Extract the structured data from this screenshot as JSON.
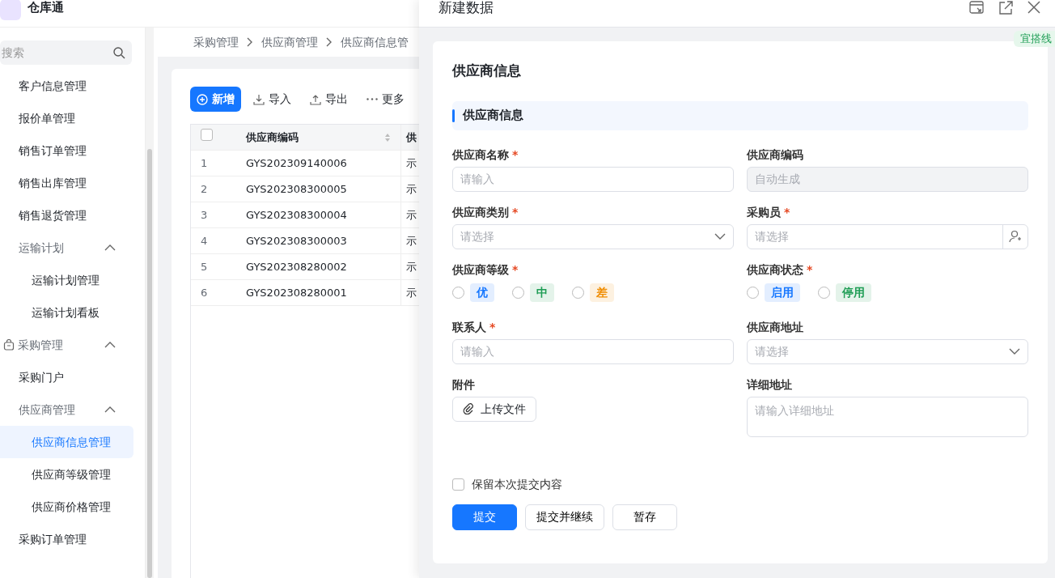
{
  "app": {
    "name": "仓库通"
  },
  "sidebar": {
    "search_placeholder": "搜索",
    "items": [
      {
        "label": "客户信息管理",
        "kind": "item",
        "selected": false
      },
      {
        "label": "报价单管理",
        "kind": "item",
        "selected": false
      },
      {
        "label": "销售订单管理",
        "kind": "item",
        "selected": false
      },
      {
        "label": "销售出库管理",
        "kind": "item",
        "selected": false
      },
      {
        "label": "销售退货管理",
        "kind": "item",
        "selected": false
      },
      {
        "label": "运输计划",
        "kind": "group",
        "expanded": true,
        "children": [
          {
            "label": "运输计划管理",
            "kind": "item",
            "selected": false
          },
          {
            "label": "运输计划看板",
            "kind": "item",
            "selected": false
          }
        ]
      },
      {
        "label": "采购管理",
        "kind": "section",
        "expanded": true,
        "children": [
          {
            "label": "采购门户",
            "kind": "item",
            "selected": false
          },
          {
            "label": "供应商管理",
            "kind": "group",
            "expanded": true,
            "children": [
              {
                "label": "供应商信息管理",
                "kind": "item",
                "selected": true
              },
              {
                "label": "供应商等级管理",
                "kind": "item",
                "selected": false
              },
              {
                "label": "供应商价格管理",
                "kind": "item",
                "selected": false
              }
            ]
          },
          {
            "label": "采购订单管理",
            "kind": "item",
            "selected": false
          }
        ]
      }
    ]
  },
  "breadcrumb": [
    "采购管理",
    "供应商管理",
    "供应商信息管"
  ],
  "toolbar": [
    {
      "label": "新增",
      "kind": "primary"
    },
    {
      "label": "导入",
      "kind": "import"
    },
    {
      "label": "导出",
      "kind": "export"
    },
    {
      "label": "更多",
      "kind": "more"
    }
  ],
  "table": {
    "select_all_checked": false,
    "columns": [
      "供应商编码",
      "供"
    ],
    "rows": [
      {
        "index": "1",
        "code": "GYS202309140006",
        "column_2": "示"
      },
      {
        "index": "2",
        "code": "GYS202308300005",
        "column_2": "示"
      },
      {
        "index": "3",
        "code": "GYS202308300004",
        "column_2": "示"
      },
      {
        "index": "4",
        "code": "GYS202308300003",
        "column_2": "示"
      },
      {
        "index": "5",
        "code": "GYS202308280002",
        "column_2": "示"
      },
      {
        "index": "6",
        "code": "GYS202308280001",
        "column_2": "示"
      }
    ]
  },
  "drawer": {
    "title": "新建数据",
    "tag": "宜搭线",
    "form_title": "供应商信息",
    "section_title": "供应商信息",
    "fields": [
      {
        "label": "供应商名称",
        "required_mark": "*",
        "kind": "text",
        "placeholder": "请输入"
      },
      {
        "label": "供应商编码",
        "kind": "disabled",
        "placeholder": "自动生成"
      },
      {
        "label": "供应商类别",
        "required_mark": "*",
        "kind": "select",
        "placeholder": "请选择"
      },
      {
        "label": "采购员",
        "required_mark": "*",
        "kind": "user",
        "placeholder": "请选择"
      },
      {
        "label": "供应商等级",
        "required_mark": "*",
        "kind": "radio",
        "options": [
          {
            "label": "优",
            "selected": false,
            "color": "#1677ff"
          },
          {
            "label": "中",
            "selected": false,
            "color": "#1f9d55"
          },
          {
            "label": "差",
            "selected": false,
            "color": "#f08c00"
          }
        ]
      },
      {
        "label": "供应商状态",
        "required_mark": "*",
        "kind": "radio",
        "options": [
          {
            "label": "启用",
            "selected": false,
            "color": "#1677ff"
          },
          {
            "label": "停用",
            "selected": false,
            "color": "#1f9d55"
          }
        ]
      },
      {
        "label": "联系人",
        "required_mark": "*",
        "kind": "text",
        "placeholder": "请输入"
      },
      {
        "label": "供应商地址",
        "kind": "select",
        "placeholder": "请选择"
      },
      {
        "label": "附件",
        "kind": "upload",
        "button": "上传文件"
      },
      {
        "label": "详细地址",
        "kind": "textarea",
        "placeholder": "请输入详细地址"
      }
    ],
    "keep_content": {
      "label": "保留本次提交内容",
      "checked": false
    },
    "buttons": [
      {
        "label": "提交",
        "kind": "primary"
      },
      {
        "label": "提交并继续",
        "kind": "default"
      },
      {
        "label": "暂存",
        "kind": "default"
      }
    ]
  }
}
